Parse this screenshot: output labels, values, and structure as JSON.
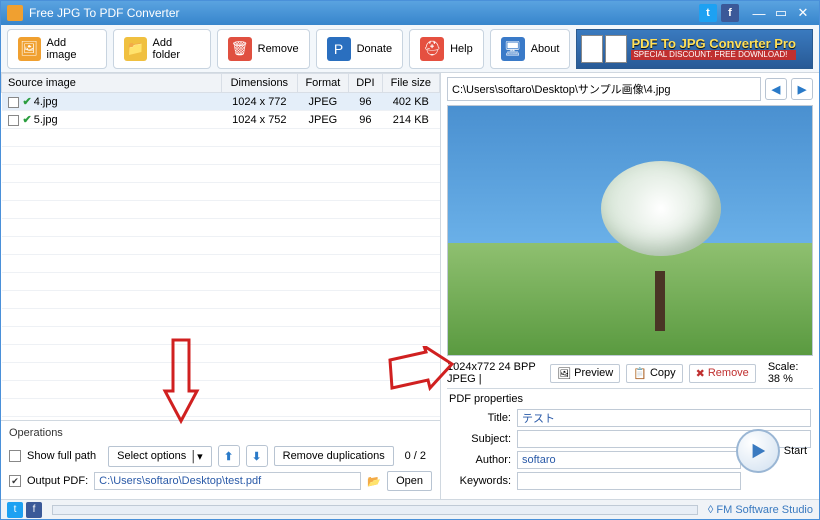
{
  "app": {
    "title": "Free JPG To PDF Converter"
  },
  "toolbar": {
    "add_image": "Add image",
    "add_folder": "Add folder",
    "remove": "Remove",
    "donate": "Donate",
    "help": "Help",
    "about": "About"
  },
  "ad": {
    "line1": "PDF To JPG Converter Pro",
    "line2": "SPECIAL DISCOUNT. FREE DOWNLOAD!"
  },
  "grid": {
    "cols": {
      "source": "Source image",
      "dimensions": "Dimensions",
      "format": "Format",
      "dpi": "DPI",
      "filesize": "File size"
    },
    "rows": [
      {
        "name": "4.jpg",
        "dimensions": "1024 x 772",
        "format": "JPEG",
        "dpi": "96",
        "filesize": "402 KB",
        "selected": true
      },
      {
        "name": "5.jpg",
        "dimensions": "1024 x 752",
        "format": "JPEG",
        "dpi": "96",
        "filesize": "214 KB",
        "selected": false
      }
    ]
  },
  "ops": {
    "heading": "Operations",
    "show_full_path": "Show full path",
    "select_options": "Select options",
    "remove_dup": "Remove duplications",
    "counter": "0 / 2",
    "output_label": "Output PDF:",
    "output_path": "C:\\Users\\softaro\\Desktop\\test.pdf",
    "open": "Open"
  },
  "preview": {
    "path": "C:\\Users\\softaro\\Desktop\\サンプル画像\\4.jpg",
    "info": "1024x772  24 BPP  JPEG  |",
    "btn_preview": "Preview",
    "btn_copy": "Copy",
    "btn_remove": "Remove",
    "scale": "Scale: 38 %"
  },
  "props": {
    "heading": "PDF properties",
    "title_l": "Title:",
    "title_v": "テスト",
    "subject_l": "Subject:",
    "subject_v": "",
    "author_l": "Author:",
    "author_v": "softaro",
    "keywords_l": "Keywords:",
    "keywords_v": ""
  },
  "start": "Start",
  "footer": {
    "company": "◊ FM Software Studio"
  }
}
